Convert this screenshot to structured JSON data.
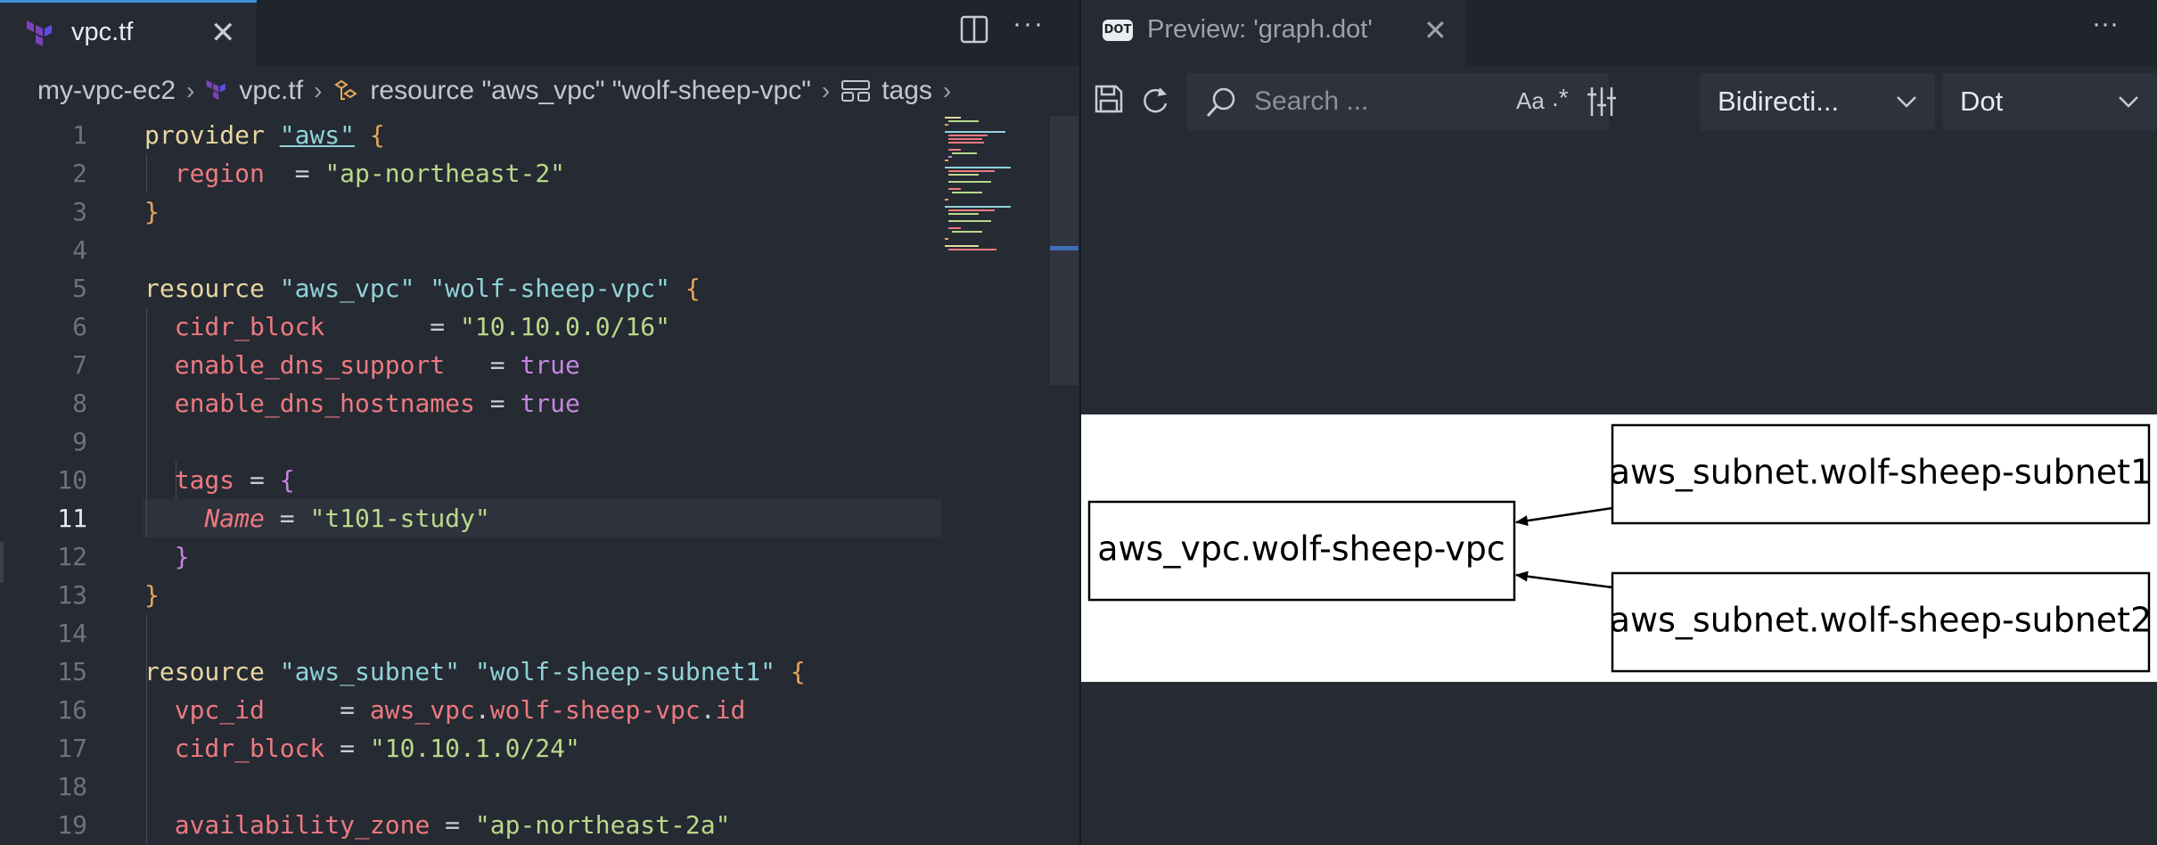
{
  "editor": {
    "tab": {
      "label": "vpc.tf",
      "icon": "terraform-icon"
    },
    "breadcrumb": {
      "project": "my-vpc-ec2",
      "file": "vpc.tf",
      "resource": "resource \"aws_vpc\" \"wolf-sheep-vpc\"",
      "symbol": "tags"
    },
    "current_line": 11,
    "line_numbers": [
      "1",
      "2",
      "3",
      "4",
      "5",
      "6",
      "7",
      "8",
      "9",
      "10",
      "11",
      "12",
      "13",
      "14",
      "15",
      "16",
      "17",
      "18",
      "19"
    ],
    "code": {
      "l1": {
        "kw": "provider",
        "name": "\"aws\"",
        "brace": "{"
      },
      "l2": {
        "attr": "region",
        "eq": "  = ",
        "val": "\"ap-northeast-2\""
      },
      "l3": {
        "brace": "}"
      },
      "l5": {
        "kw": "resource",
        "type": "\"aws_vpc\"",
        "name": "\"wolf-sheep-vpc\"",
        "brace": "{"
      },
      "l6": {
        "attr": "cidr_block",
        "eq": "       = ",
        "val": "\"10.10.0.0/16\""
      },
      "l7": {
        "attr": "enable_dns_support",
        "eq": "   = ",
        "val": "true"
      },
      "l8": {
        "attr": "enable_dns_hostnames",
        "eq": " = ",
        "val": "true"
      },
      "l10": {
        "attr": "tags",
        "eq": " = ",
        "brace": "{"
      },
      "l11": {
        "attr": "Name",
        "eq": " = ",
        "val": "\"t101-study\""
      },
      "l12": {
        "brace": "}"
      },
      "l13": {
        "brace": "}"
      },
      "l15": {
        "kw": "resource",
        "type": "\"aws_subnet\"",
        "name": "\"wolf-sheep-subnet1\"",
        "brace": "{"
      },
      "l16": {
        "attr": "vpc_id",
        "eq": "     = ",
        "ref1": "aws_vpc",
        "dot1": ".",
        "ref2": "wolf-sheep-vpc",
        "dot2": ".",
        "ref3": "id"
      },
      "l17": {
        "attr": "cidr_block",
        "eq": " = ",
        "val": "\"10.10.1.0/24\""
      },
      "l19": {
        "attr": "availability_zone",
        "eq": " = ",
        "val": "\"ap-northeast-2a\""
      }
    }
  },
  "preview": {
    "tab": {
      "badge": "DOT",
      "label": "Preview: 'graph.dot'"
    },
    "toolbar": {
      "search_placeholder": "Search ...",
      "match_case": "Aa",
      "regex": ".*",
      "direction_select": "Bidirecti...",
      "format_select": "Dot"
    },
    "graph": {
      "nodes": {
        "vpc": "aws_vpc.wolf-sheep-vpc",
        "subnet1": "aws_subnet.wolf-sheep-subnet1",
        "subnet2": "aws_subnet.wolf-sheep-subnet2"
      }
    }
  },
  "icons": [
    "terraform-icon",
    "close-icon",
    "split-editor-icon",
    "more-actions-icon",
    "chevron-right-icon",
    "symbol-class-icon",
    "symbol-field-icon",
    "save-icon",
    "refresh-icon",
    "search-icon",
    "filter-icon",
    "chevron-down-icon"
  ],
  "colors": {
    "accent": "#3d8fd8",
    "background": "#262a33",
    "tabbar": "#20242c",
    "terraform_purple": "#7b42bc"
  }
}
